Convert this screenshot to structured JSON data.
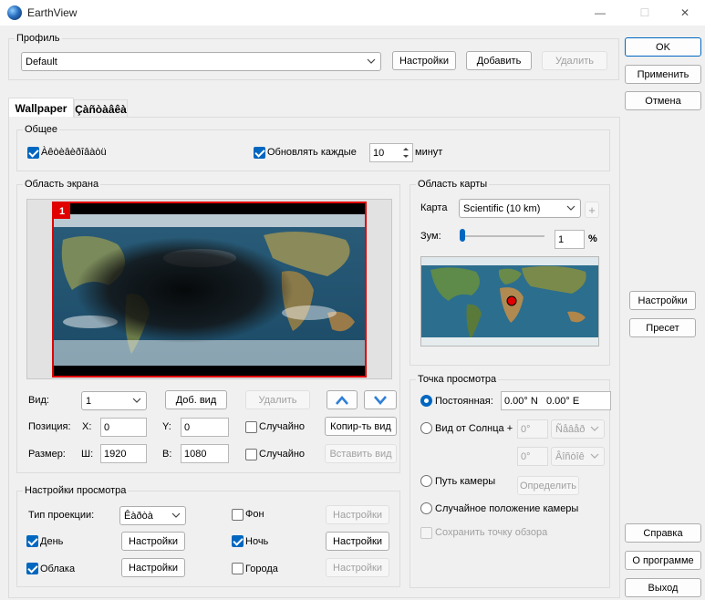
{
  "window": {
    "title": "EarthView",
    "minimize": "—",
    "maximize": "☐",
    "close": "✕"
  },
  "profile": {
    "legend": "Профиль",
    "selected": "Default",
    "settings_btn": "Настройки",
    "add_btn": "Добавить",
    "delete_btn": "Удалить"
  },
  "side": {
    "ok": "OK",
    "apply": "Применить",
    "cancel": "Отмена",
    "settings": "Настройки",
    "preset": "Пресет",
    "help": "Справка",
    "about": "О программе",
    "exit": "Выход"
  },
  "tabs": [
    {
      "label": "Wallpaper"
    },
    {
      "label": "Çàñòàâêà"
    }
  ],
  "general": {
    "legend": "Общее",
    "autorun_label": "Àêòèâèðîâàòü",
    "autorun_checked": true,
    "update_label": "Обновлять каждые",
    "update_checked": true,
    "update_value": "10",
    "minutes": "минут"
  },
  "screen": {
    "legend": "Область экрана",
    "monitor_badge": "1",
    "view_label": "Вид:",
    "view_value": "1",
    "add_view": "Доб. вид",
    "delete_view": "Удалить",
    "up_icon": "chevron-up",
    "down_icon": "chevron-down",
    "position_label": "Позиция:",
    "x_label": "X:",
    "x_value": "0",
    "y_label": "Y:",
    "y_value": "0",
    "random1": "Случайно",
    "copy_view": "Копир-ть вид",
    "size_label": "Размер:",
    "w_label": "Ш:",
    "w_value": "1920",
    "h_label": "В:",
    "h_value": "1080",
    "random2": "Случайно",
    "paste_view": "Вставить вид"
  },
  "map_area": {
    "legend": "Область карты",
    "map_label": "Карта",
    "map_value": "Scientific (10 km)",
    "zoom_label": "Зум:",
    "zoom_value": "1",
    "zoom_unit": "%",
    "zoom_fraction": 0.01,
    "plus": "+"
  },
  "viewpoint": {
    "legend": "Точка просмотра",
    "fixed_label": "Постоянная:",
    "fixed_value": "0.00° N   0.00° E",
    "sun_label": "Вид от Солнца +",
    "sun_deg1": "0°",
    "sun_sel1": "Ñåâåð",
    "sun_deg2": "0°",
    "sun_sel2": "Âîñòîê",
    "camera_label": "Путь камеры",
    "determine": "Определить",
    "random_camera": "Случайное положение камеры",
    "save_view": "Сохранить точку обзора"
  },
  "display": {
    "legend": "Настройки просмотра",
    "projection_label": "Тип проекции:",
    "projection_value": "Êàðòà",
    "background_label": "Фон",
    "background_settings": "Настройки",
    "day_label": "День",
    "day_settings": "Настройки",
    "night_label": "Ночь",
    "night_settings": "Настройки",
    "clouds_label": "Облака",
    "clouds_settings": "Настройки",
    "cities_label": "Города",
    "cities_settings": "Настройки"
  },
  "colors": {
    "accent": "#0067c0",
    "monitor_border": "#e00000",
    "marker": "#e00000"
  }
}
